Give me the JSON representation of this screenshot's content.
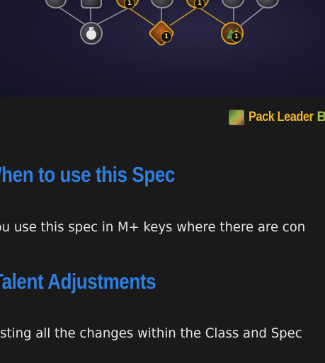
{
  "talent_tree": {
    "nodes": [
      {
        "kind": "grey",
        "icon": "beast-skull-icon"
      },
      {
        "kind": "grey",
        "icon": "pet-icon"
      },
      {
        "kind": "gold",
        "icon": "arrow-icon",
        "rank": "1"
      },
      {
        "kind": "grey",
        "icon": "claw-icon"
      },
      {
        "kind": "gold",
        "icon": "beast-icon",
        "rank": "1"
      },
      {
        "kind": "grey",
        "icon": "paw-icon"
      },
      {
        "kind": "grey",
        "icon": "wolf-icon"
      },
      {
        "kind": "grey",
        "icon": "potion-icon"
      },
      {
        "kind": "gold-choice",
        "icon": "beast-cleave-icon",
        "rank": "1"
      },
      {
        "kind": "gold",
        "icon": "bloodshed-icon",
        "rank": "1"
      }
    ]
  },
  "hero_spec": {
    "icon": "pack-leader-icon",
    "name": "Pack Leader",
    "extra": "B"
  },
  "sections": [
    {
      "heading": "When to use this Spec",
      "text": "You use this spec in M+ keys where there are con"
    },
    {
      "heading": "Talent Adjustments",
      "text": "Listing all the changes within the Class and Spec"
    }
  ],
  "colors": {
    "heading": "#2f7ee0",
    "hero_name": "#f1b82f",
    "hero_extra": "#a6c54a",
    "background": "#1a1a1b",
    "body_text": "#e6e6e6"
  }
}
